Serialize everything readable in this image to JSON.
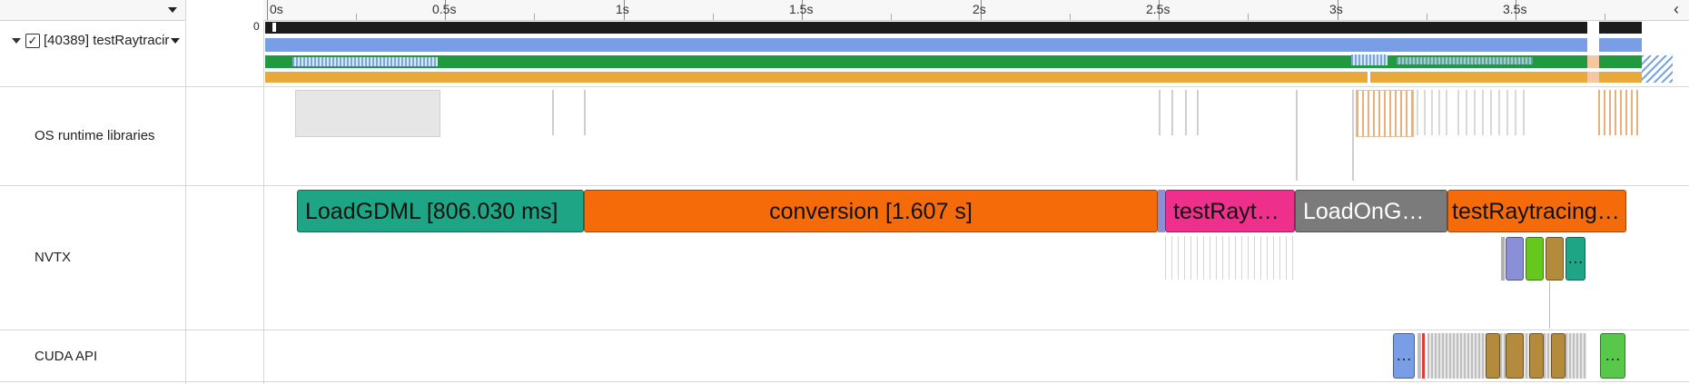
{
  "ruler": {
    "menu_icon": "triangle-down-icon",
    "ticks": [
      "0s",
      "0.5s",
      "1s",
      "1.5s",
      "2s",
      "2.5s",
      "3s",
      "3.5s"
    ],
    "scroll_glyph": "‹"
  },
  "process": {
    "label": "[40389] testRaytracir",
    "checked": "✓",
    "counter_zero": "0",
    "expand_glyph": "▼"
  },
  "rows": {
    "os_runtime": "OS runtime libraries",
    "nvtx": "NVTX",
    "cuda_api": "CUDA API"
  },
  "nvtx_ranges": [
    {
      "label": "LoadGDML [806.030 ms]",
      "color": "#1ea585",
      "text_color": "#111111"
    },
    {
      "label": "conversion [1.607 s]",
      "color": "#f56b0a",
      "text_color": "#111111"
    },
    {
      "label": "testRaytr…",
      "color": "#ef2f8c",
      "text_color": "#111111"
    },
    {
      "label": "LoadOnGP…",
      "color": "#7b7b7b",
      "text_color": "#ffffff"
    },
    {
      "label": "testRaytracing…",
      "color": "#f56b0a",
      "text_color": "#111111"
    }
  ],
  "nvtx_small": {
    "more": "…"
  },
  "cuda_small": {
    "more_left": "…",
    "more_right": "…"
  },
  "colors": {
    "timeline_black": "#1b1b1b",
    "timeline_blue": "#7a9ee6",
    "timeline_green": "#1f9a3e",
    "timeline_orange": "#e9a83a",
    "grid": "#d6d6d6"
  }
}
